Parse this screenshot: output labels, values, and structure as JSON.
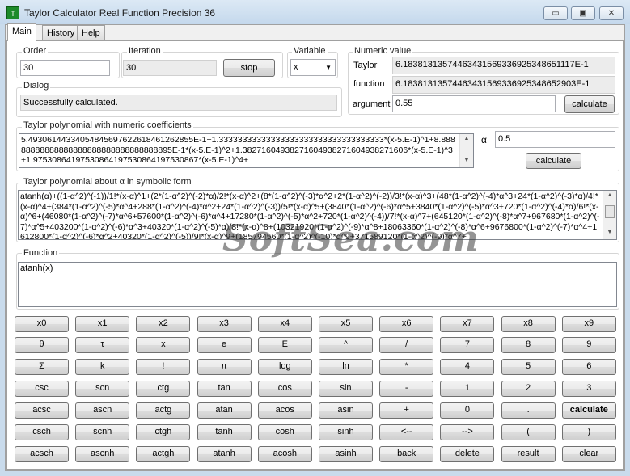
{
  "window": {
    "title": "Taylor Calculator Real Function Precision 36",
    "minimize": "▭",
    "maximize": "▣",
    "close": "✕",
    "icon_label": "T"
  },
  "tabs": [
    {
      "label": "Main"
    },
    {
      "label": "History"
    },
    {
      "label": "Help"
    }
  ],
  "order": {
    "label": "Order",
    "value": "30"
  },
  "iteration": {
    "label": "Iteration",
    "value": "30",
    "stop_label": "stop"
  },
  "variable": {
    "label": "Variable",
    "value": "x"
  },
  "dialog": {
    "label": "Dialog",
    "message": "Successfully calculated."
  },
  "numeric": {
    "label": "Numeric value",
    "taylor_label": "Taylor",
    "taylor_value": "6.18381313574463431569336925348651117E-1",
    "function_label": "function",
    "function_value": "6.18381313574463431569336925348652903E-1",
    "argument_label": "argument",
    "argument_value": "0.55",
    "calculate_label": "calculate"
  },
  "polynomial": {
    "label": "Taylor polynomial with numeric coefficients",
    "text": "5.49306144334054845697622618461262855E-1+1.33333333333333333333333333333333333*(x-5.E-1)^1+8.88888888888888888888888888888888895E-1*(x-5.E-1)^2+1.38271604938271604938271604938271606*(x-5.E-1)^3+1.97530864197530864197530864197530867*(x-5.E-1)^4+",
    "alpha_label": "α",
    "alpha_value": "0.5",
    "calculate_label": "calculate"
  },
  "symbolic": {
    "label": "Taylor polynomial about α in symbolic form",
    "text": "atanh(α)+((1-α^2)^(-1))/1!*(x-α)^1+(2*(1-α^2)^(-2)*α)/2!*(x-α)^2+(8*(1-α^2)^(-3)*α^2+2*(1-α^2)^(-2))/3!*(x-α)^3+(48*(1-α^2)^(-4)*α^3+24*(1-α^2)^(-3)*α)/4!*(x-α)^4+(384*(1-α^2)^(-5)*α^4+288*(1-α^2)^(-4)*α^2+24*(1-α^2)^(-3))/5!*(x-α)^5+(3840*(1-α^2)^(-6)*α^5+3840*(1-α^2)^(-5)*α^3+720*(1-α^2)^(-4)*α)/6!*(x-α)^6+(46080*(1-α^2)^(-7)*α^6+57600*(1-α^2)^(-6)*α^4+17280*(1-α^2)^(-5)*α^2+720*(1-α^2)^(-4))/7!*(x-α)^7+(645120*(1-α^2)^(-8)*α^7+967680*(1-α^2)^(-7)*α^5+403200*(1-α^2)^(-6)*α^3+40320*(1-α^2)^(-5)*α)/8!*(x-α)^8+(10321920*(1-α^2)^(-9)*α^8+18063360*(1-α^2)^(-8)*α^6+9676800*(1-α^2)^(-7)*α^4+1612800*(1-α^2)^(-6)*α^2+40320*(1-α^2)^(-5))/9!*(x-α)^9+(185794560*(1-α^2)^(-10)*α^9+371589120*(1-α^2)^(-9)*α^7+"
  },
  "function": {
    "label": "Function",
    "value": "atanh(x)"
  },
  "keypad": [
    [
      "x0",
      "x1",
      "x2",
      "x3",
      "x4",
      "x5",
      "x6",
      "x7",
      "x8",
      "x9"
    ],
    [
      "θ",
      "τ",
      "x",
      "e",
      "E",
      "^",
      "/",
      "7",
      "8",
      "9"
    ],
    [
      "Σ",
      "k",
      "!",
      "π",
      "log",
      "ln",
      "*",
      "4",
      "5",
      "6"
    ],
    [
      "csc",
      "scn",
      "ctg",
      "tan",
      "cos",
      "sin",
      "-",
      "1",
      "2",
      "3"
    ],
    [
      "acsc",
      "ascn",
      "actg",
      "atan",
      "acos",
      "asin",
      "+",
      "0",
      ".",
      "calculate"
    ],
    [
      "csch",
      "scnh",
      "ctgh",
      "tanh",
      "cosh",
      "sinh",
      "<--",
      "-->",
      "(",
      ")"
    ],
    [
      "acsch",
      "ascnh",
      "actgh",
      "atanh",
      "acosh",
      "asinh",
      "back",
      "delete",
      "result",
      "clear"
    ]
  ],
  "watermark": "SoftSea.com"
}
